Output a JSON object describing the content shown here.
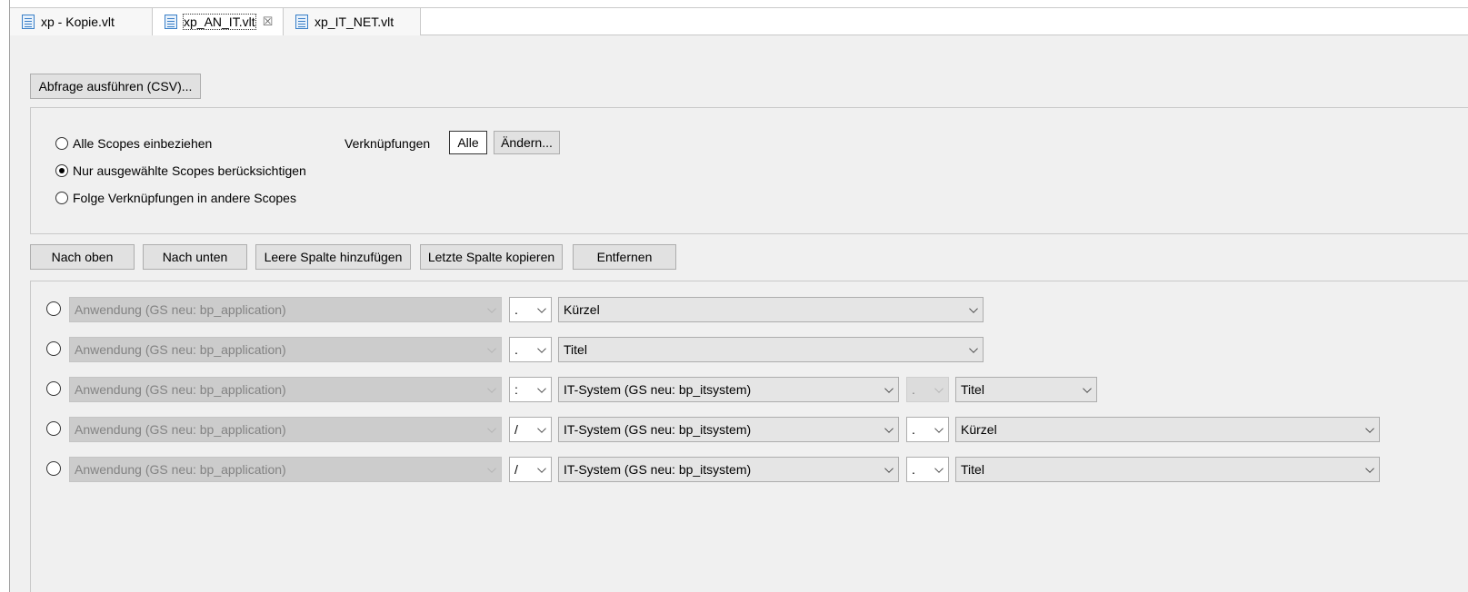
{
  "tabs": [
    {
      "label": "xp - Kopie.vlt",
      "active": false,
      "icon": "document-icon"
    },
    {
      "label": "xp_AN_IT.vlt",
      "active": true,
      "icon": "document-icon",
      "close": "☒"
    },
    {
      "label": "xp_IT_NET.vlt",
      "active": false,
      "icon": "document-icon"
    }
  ],
  "toolbar": {
    "run_query_label": "Abfrage ausführen (CSV)..."
  },
  "scope": {
    "options": [
      {
        "label": "Alle Scopes einbeziehen",
        "checked": false
      },
      {
        "label": "Nur ausgewählte Scopes berücksichtigen",
        "checked": true
      },
      {
        "label": "Folge Verknüpfungen in andere Scopes",
        "checked": false
      }
    ],
    "links_label": "Verknüpfungen",
    "all_label": "Alle",
    "change_label": "Ändern..."
  },
  "actions": {
    "up": "Nach oben",
    "down": "Nach unten",
    "add_empty": "Leere Spalte hinzufügen",
    "copy_last": "Letzte Spalte kopieren",
    "remove": "Entfernen"
  },
  "rows": [
    {
      "entity": "Anwendung (GS neu: bp_application)",
      "sep1": ".",
      "attr": "Kürzel"
    },
    {
      "entity": "Anwendung (GS neu: bp_application)",
      "sep1": ".",
      "attr": "Titel"
    },
    {
      "entity": "Anwendung (GS neu: bp_application)",
      "sep1": ":",
      "target": "IT-System (GS neu: bp_itsystem)",
      "sep2": ".",
      "attr": "Titel"
    },
    {
      "entity": "Anwendung (GS neu: bp_application)",
      "sep1": "/",
      "target": "IT-System (GS neu: bp_itsystem)",
      "sep2": ".",
      "attr": "Kürzel"
    },
    {
      "entity": "Anwendung (GS neu: bp_application)",
      "sep1": "/",
      "target": "IT-System (GS neu: bp_itsystem)",
      "sep2": ".",
      "attr": "Titel"
    }
  ],
  "colors": {
    "panel_bg": "#f0f0f0",
    "button_bg": "#e1e1e1",
    "disabled_combo_bg": "#cccccc",
    "icon_blue": "#3a7fc7"
  }
}
